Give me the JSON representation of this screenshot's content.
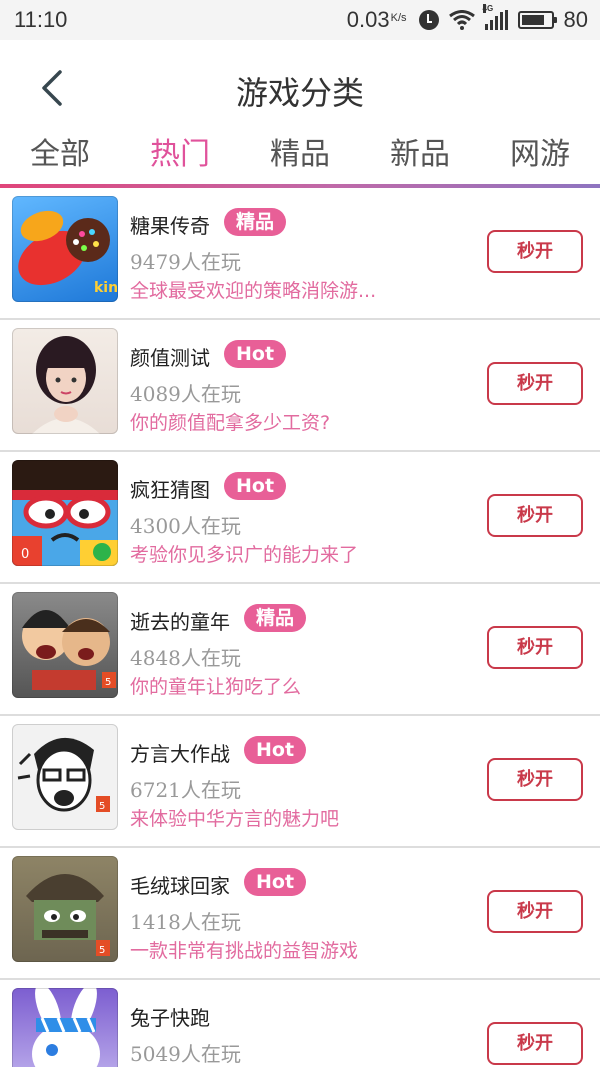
{
  "status_bar": {
    "time": "11:10",
    "net_speed": "0.03",
    "net_unit": "K/s",
    "network": "4G",
    "battery": "80",
    "battery_level_percent": 80,
    "icons": [
      "alarm-icon",
      "wifi-icon",
      "signal-icon",
      "battery-icon"
    ]
  },
  "header": {
    "title": "游戏分类",
    "back_icon": "chevron-left-icon"
  },
  "tabs": [
    {
      "label": "全部",
      "active": false
    },
    {
      "label": "热门",
      "active": true
    },
    {
      "label": "精品",
      "active": false
    },
    {
      "label": "新品",
      "active": false
    },
    {
      "label": "网游",
      "active": false
    }
  ],
  "colors": {
    "accent": "#e0529b",
    "badge": "#e85f97",
    "button": "#c9394a",
    "desc": "#e26b9f"
  },
  "games": [
    {
      "name": "糖果传奇",
      "badge": "精品",
      "players": "9479人在玩",
      "desc": "全球最受欢迎的策略消除游...",
      "button": "秒开",
      "icon": "candy-game-icon"
    },
    {
      "name": "颜值测试",
      "badge": "Hot",
      "players": "4089人在玩",
      "desc": "你的颜值配拿多少工资?",
      "button": "秒开",
      "icon": "girl-portrait-icon"
    },
    {
      "name": "疯狂猜图",
      "badge": "Hot",
      "players": "4300人在玩",
      "desc": "考验你见多识广的能力来了",
      "button": "秒开",
      "icon": "glasses-face-icon"
    },
    {
      "name": "逝去的童年",
      "badge": "精品",
      "players": "4848人在玩",
      "desc": "你的童年让狗吃了么",
      "button": "秒开",
      "icon": "cartoon-kids-icon"
    },
    {
      "name": "方言大作战",
      "badge": "Hot",
      "players": "6721人在玩",
      "desc": "来体验中华方言的魅力吧",
      "button": "秒开",
      "icon": "comic-man-icon"
    },
    {
      "name": "毛绒球回家",
      "badge": "Hot",
      "players": "1418人在玩",
      "desc": "一款非常有挑战的益智游戏",
      "button": "秒开",
      "icon": "furball-icon"
    },
    {
      "name": "兔子快跑",
      "badge": "",
      "players": "5049人在玩",
      "desc": "",
      "button": "秒开",
      "icon": "rabbit-icon"
    }
  ]
}
